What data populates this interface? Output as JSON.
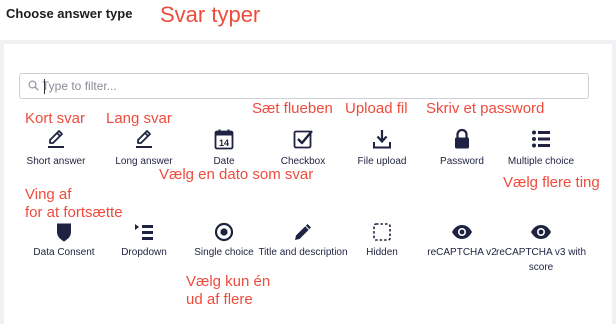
{
  "header": {
    "title": "Choose answer type"
  },
  "annotations": {
    "title_note": "Svar typer",
    "short_answer_note": "Kort svar",
    "long_answer_note": "Lang svar",
    "checkbox_note": "Sæt flueben",
    "file_upload_note": "Upload fil",
    "password_note": "Skriv et password",
    "date_note": "Vælg en dato som svar",
    "multiple_choice_note": "Vælg flere ting",
    "consent_note_line1": "Ving af",
    "consent_note_line2": "for at fortsætte",
    "single_choice_note_line1": "Vælg kun én",
    "single_choice_note_line2": "ud af flere"
  },
  "filter": {
    "placeholder": "Type to filter..."
  },
  "types_row1": [
    {
      "label": "Short answer",
      "icon": "pencil-underline-icon"
    },
    {
      "label": "Long answer",
      "icon": "pencil-underline-icon"
    },
    {
      "label": "Date",
      "icon": "calendar-icon",
      "icon_text": "14"
    },
    {
      "label": "Checkbox",
      "icon": "checkbox-icon"
    },
    {
      "label": "File upload",
      "icon": "upload-icon"
    },
    {
      "label": "Password",
      "icon": "lock-icon"
    },
    {
      "label": "Multiple choice",
      "icon": "list-icon"
    }
  ],
  "types_row2": [
    {
      "label": "Data Consent",
      "icon": "shield-icon"
    },
    {
      "label": "Dropdown",
      "icon": "dropdown-list-icon"
    },
    {
      "label": "Single choice",
      "icon": "radio-icon"
    },
    {
      "label": "Title and description",
      "icon": "pencil-icon"
    },
    {
      "label": "Hidden",
      "icon": "dashed-square-icon"
    },
    {
      "label": "reCAPTCHA v2",
      "icon": "eye-icon"
    },
    {
      "label": "reCAPTCHA v3 with score",
      "icon": "eye-icon"
    }
  ],
  "colors": {
    "icon": "#1f2240",
    "annotation": "#ef4b3d",
    "background": "#f1f1f3"
  }
}
